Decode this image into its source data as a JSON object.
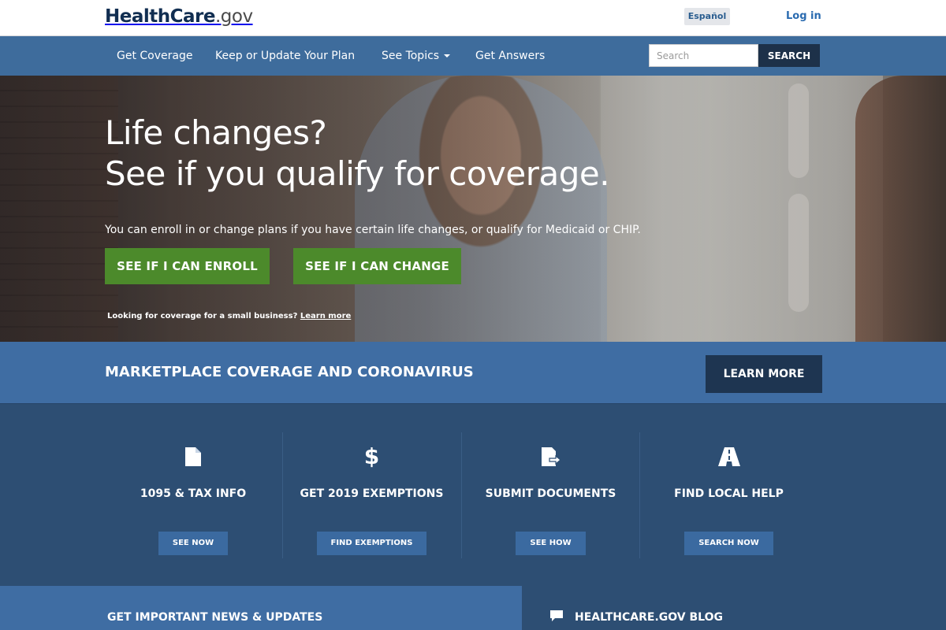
{
  "header": {
    "logo_main": "HealthCare",
    "logo_tld": ".gov",
    "espanol_label": "Español",
    "login_label": "Log in"
  },
  "nav": {
    "items": [
      "Get Coverage",
      "Keep or Update Your Plan",
      "See Topics",
      "Get Answers"
    ],
    "search_placeholder": "Search",
    "search_button": "SEARCH"
  },
  "hero": {
    "headline_line1": "Life changes?",
    "headline_line2": "See if you qualify for coverage.",
    "subtext": "You can enroll in or change plans if you have certain life changes, or qualify for Medicaid or CHIP.",
    "btn_enroll": "SEE IF I CAN ENROLL",
    "btn_change": "SEE IF I CAN CHANGE",
    "small_business_text": "Looking for coverage for a small business?",
    "small_business_link": "Learn more"
  },
  "banner": {
    "title": "MARKETPLACE COVERAGE AND CORONAVIRUS",
    "button": "LEARN MORE"
  },
  "tiles": [
    {
      "icon": "document-icon",
      "title": "1095 & TAX INFO",
      "button": "SEE NOW"
    },
    {
      "icon": "dollar-icon",
      "title": "GET 2019 EXEMPTIONS",
      "button": "FIND EXEMPTIONS"
    },
    {
      "icon": "document-upload-icon",
      "title": "SUBMIT DOCUMENTS",
      "button": "SEE HOW"
    },
    {
      "icon": "road-icon",
      "title": "FIND LOCAL HELP",
      "button": "SEARCH NOW"
    }
  ],
  "bottom": {
    "news_title": "GET IMPORTANT NEWS & UPDATES",
    "blog_title": "HEALTHCARE.GOV BLOG"
  },
  "colors": {
    "nav_blue": "#3e6c9c",
    "green_button": "#4c8a2b",
    "dark_navy": "#1e3551",
    "tiles_bg": "#2d4e73"
  }
}
